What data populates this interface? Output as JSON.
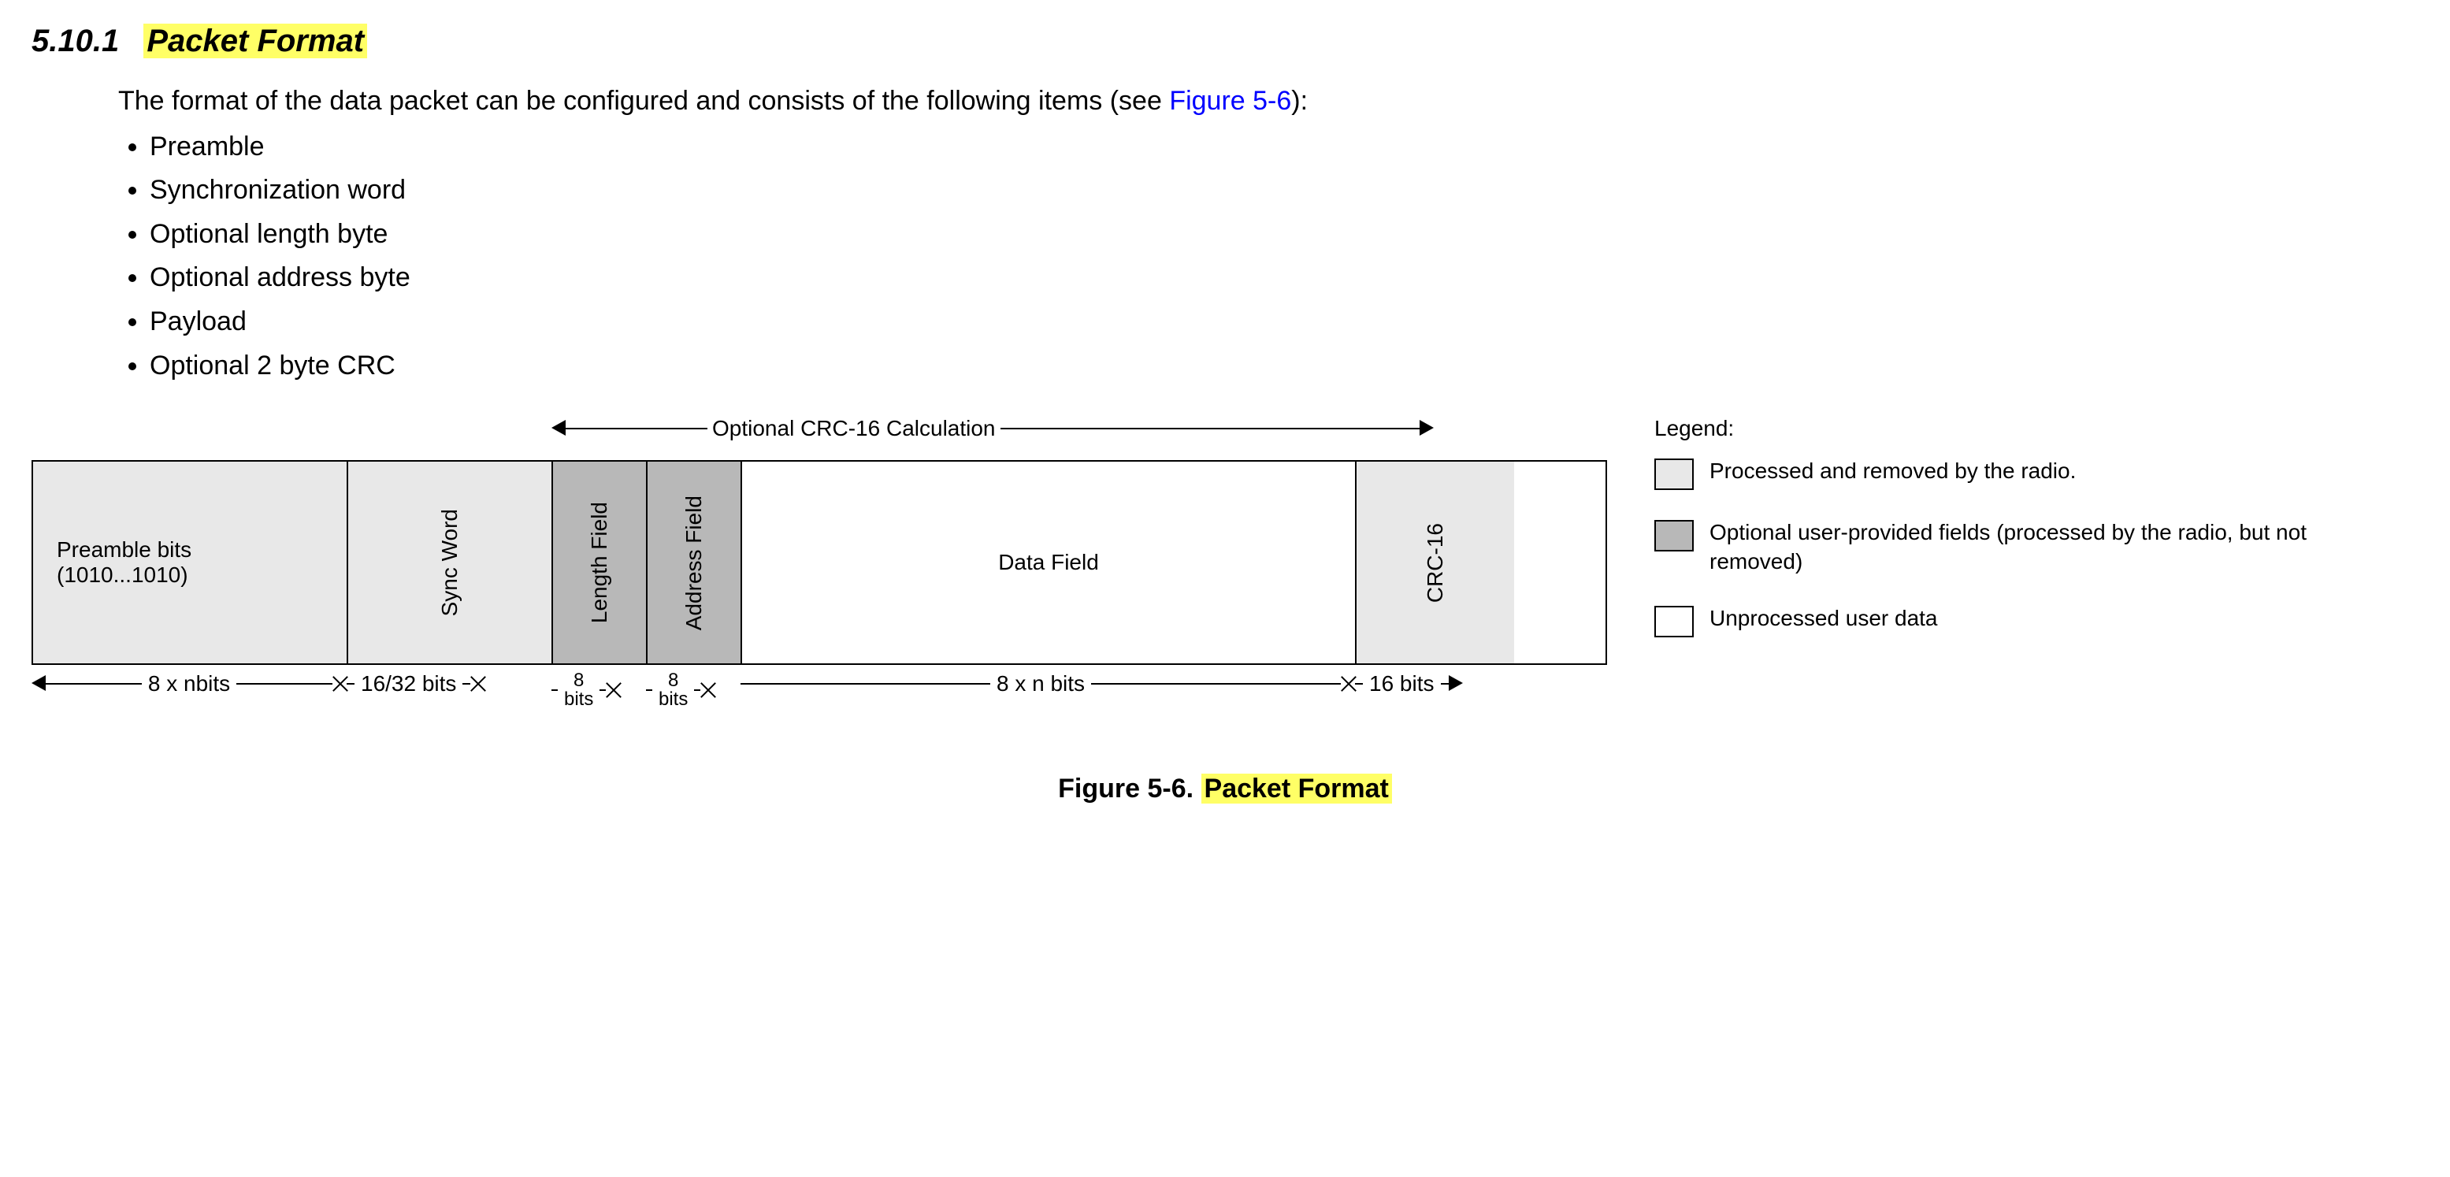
{
  "section": {
    "number": "5.10.1",
    "title": "Packet Format"
  },
  "intro": {
    "text_before": "The format of the data packet can be configured and consists of the following items (see ",
    "link": "Figure 5-6",
    "text_after": "):"
  },
  "items": [
    "Preamble",
    "Synchronization word",
    "Optional length byte",
    "Optional address byte",
    "Payload",
    "Optional 2 byte CRC"
  ],
  "diagram": {
    "crc_span_label": "Optional CRC-16 Calculation",
    "fields": {
      "preamble_l1": "Preamble bits",
      "preamble_l2": "(1010...1010)",
      "sync": "Sync Word",
      "length": "Length Field",
      "address": "Address Field",
      "data": "Data Field",
      "crc": "CRC-16"
    },
    "dims": {
      "preamble": "8 x nbits",
      "sync": "16/32  bits",
      "length_top": "8",
      "length_bot": "bits",
      "address_top": "8",
      "address_bot": "bits",
      "data": "8 x n bits",
      "crc": "16  bits"
    }
  },
  "legend": {
    "title": "Legend:",
    "rows": [
      "Processed and removed by the radio.",
      "Optional user-provided fields (processed by the radio, but not removed)",
      "Unprocessed user data"
    ]
  },
  "caption": {
    "prefix": "Figure 5-6. ",
    "title": "Packet Format"
  }
}
